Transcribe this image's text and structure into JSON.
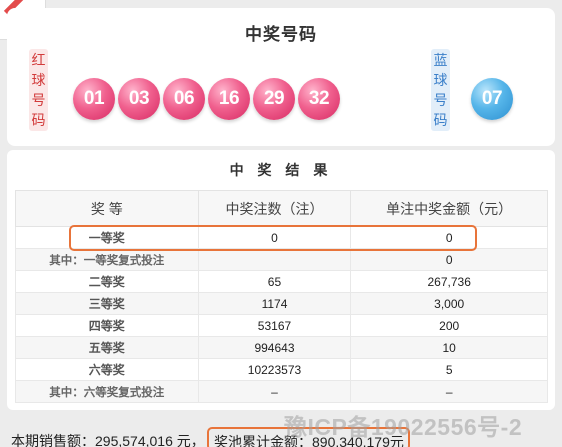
{
  "header": {
    "title": "中奖号码"
  },
  "red_label": [
    "红",
    "球",
    "号",
    "码"
  ],
  "blue_label": [
    "蓝",
    "球",
    "号",
    "码"
  ],
  "red_balls": [
    "01",
    "03",
    "06",
    "16",
    "29",
    "32"
  ],
  "blue_ball": "07",
  "results": {
    "title": "中 奖 结 果",
    "columns": [
      "奖 等",
      "中奖注数（注）",
      "单注中奖金额（元）"
    ],
    "rows": [
      {
        "level": "一等奖",
        "count": "0",
        "amount": "0"
      },
      {
        "level": "其中：一等奖复式投注",
        "count": "",
        "amount": "0"
      },
      {
        "level": "二等奖",
        "count": "65",
        "amount": "267,736"
      },
      {
        "level": "三等奖",
        "count": "1174",
        "amount": "3,000"
      },
      {
        "level": "四等奖",
        "count": "53167",
        "amount": "200"
      },
      {
        "level": "五等奖",
        "count": "994643",
        "amount": "10"
      },
      {
        "level": "六等奖",
        "count": "10223573",
        "amount": "5"
      },
      {
        "level": "其中：六等奖复式投注",
        "count": "–",
        "amount": "–"
      }
    ]
  },
  "footer": {
    "sales": "本期销售额：295,574,016 元，",
    "pool": "奖池累计金额：890,340,179元"
  },
  "watermark": "豫ICP备19022556号-2",
  "colors": {
    "red_ball": "#f0608e",
    "blue_ball": "#55b5e9",
    "highlight": "#e8743a"
  }
}
